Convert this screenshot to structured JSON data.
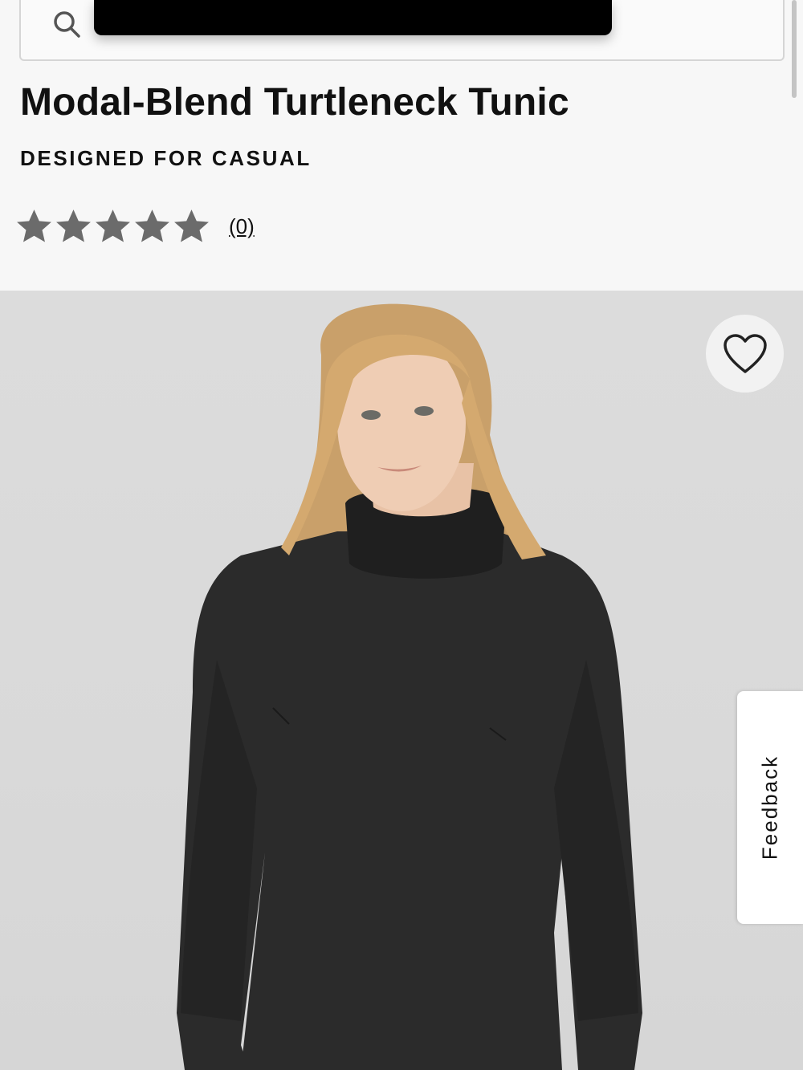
{
  "search": {
    "icon": "search-icon"
  },
  "product": {
    "title": "Modal-Blend Turtleneck Tunic",
    "tag": "DESIGNED FOR CASUAL",
    "rating": {
      "stars": 5,
      "filled": 0,
      "review_count": "(0)"
    }
  },
  "image": {
    "alt": "Woman wearing a black modal-blend turtleneck tunic"
  },
  "wishlist": {
    "icon": "heart-icon"
  },
  "feedback": {
    "label": "Feedback"
  },
  "colors": {
    "star": "#6b6b6b",
    "text": "#111111",
    "background": "#f7f7f7"
  }
}
